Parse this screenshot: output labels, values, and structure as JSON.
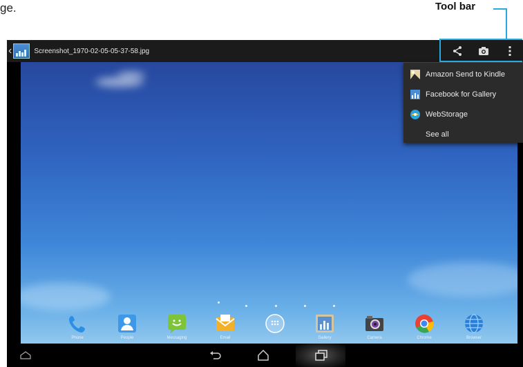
{
  "page_fragment": "ge.",
  "callout": {
    "label": "Tool bar"
  },
  "action_bar": {
    "title": "Screenshot_1970-02-05-05-37-58.jpg"
  },
  "toolbar_icons": [
    "share-icon",
    "camera-icon",
    "overflow-menu-icon"
  ],
  "overflow_menu": {
    "items": [
      {
        "label": "Amazon Send to Kindle",
        "icon": "kindle-icon"
      },
      {
        "label": "Facebook for Gallery",
        "icon": "gallery-icon"
      },
      {
        "label": "WebStorage",
        "icon": "webstorage-icon"
      },
      {
        "label": "See all",
        "icon": ""
      }
    ]
  },
  "dock": {
    "apps": [
      {
        "label": "Phone",
        "icon": "phone-icon",
        "color": "#2d8fe3"
      },
      {
        "label": "People",
        "icon": "people-icon",
        "color": "#3d98e8"
      },
      {
        "label": "Messaging",
        "icon": "messaging-icon",
        "color": "#7ec43a"
      },
      {
        "label": "Email",
        "icon": "email-icon",
        "color": "#f3b02a"
      },
      {
        "label": "",
        "icon": "all-apps-icon",
        "color": "#9aa7b8"
      },
      {
        "label": "Gallery",
        "icon": "gallery-icon",
        "color": "#5a8fd0"
      },
      {
        "label": "Camera",
        "icon": "camera-icon",
        "color": "#444444"
      },
      {
        "label": "Chrome",
        "icon": "chrome-icon",
        "color": "#e94235"
      },
      {
        "label": "Browser",
        "icon": "browser-icon",
        "color": "#2a7fd6"
      }
    ]
  },
  "photo_toolbar_icons": [
    "favorite-icon",
    "bookmark-icon",
    "edit-icon",
    "delete-icon"
  ],
  "nav_icons": [
    "back-icon",
    "home-icon",
    "recent-apps-icon"
  ],
  "colors": {
    "accent": "#29a9e1",
    "action_bar": "#1b1b1b",
    "menu_bg": "#2b2b2b"
  }
}
